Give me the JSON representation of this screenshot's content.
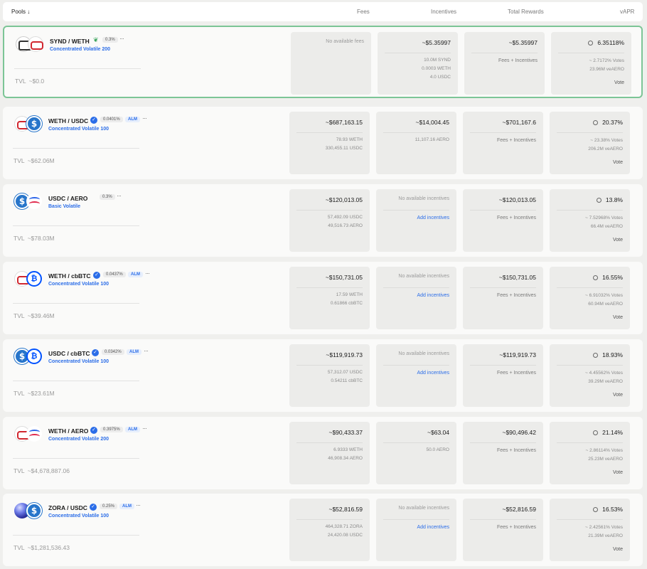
{
  "header": {
    "pools": "Pools ↓",
    "fees": "Fees",
    "incentives": "Incentives",
    "total_rewards": "Total Rewards",
    "vapr": "vAPR"
  },
  "common": {
    "tvl_label": "TVL",
    "no_fees": "No available fees",
    "no_incentives": "No available incentives",
    "add_incentives": "Add incentives",
    "fees_incentives": "Fees + Incentives",
    "vote": "Vote",
    "votes_suffix": "Votes",
    "veaero_suffix": "veAERO",
    "more": "···"
  },
  "pools": [
    {
      "pair": "SYND / WETH",
      "fee": "0.3%",
      "type": "Concentrated Volatile 200",
      "tvl": "~$0.0",
      "fees": {
        "na": "No available fees"
      },
      "incentives": {
        "total": "~$5.35997",
        "lines": [
          "10.0M SYND",
          "0.0003 WETH",
          "4.0 USDC"
        ]
      },
      "total": "~$5.35997",
      "vapr": "6.35118%",
      "votes": "~ 2.7172% Votes",
      "veaero": "23.96M veAERO"
    },
    {
      "pair": "WETH / USDC",
      "fee": "0.0401%",
      "alm": "ALM",
      "type": "Concentrated Volatile 100",
      "tvl": "~$62.06M",
      "fees": {
        "total": "~$687,163.15",
        "lines": [
          "78.93 WETH",
          "330,455.11 USDC"
        ]
      },
      "incentives": {
        "total": "~$14,004.45",
        "lines": [
          "11,107.16 AERO"
        ]
      },
      "total": "~$701,167.6",
      "vapr": "20.37%",
      "votes": "~ 23.38% Votes",
      "veaero": "206.2M veAERO"
    },
    {
      "pair": "USDC / AERO",
      "fee": "0.3%",
      "type": "Basic Volatile",
      "tvl": "~$78.03M",
      "fees": {
        "total": "~$120,013.05",
        "lines": [
          "57,492.09 USDC",
          "49,516.73 AERO"
        ]
      },
      "incentives": {
        "na": "No available incentives"
      },
      "total": "~$120,013.05",
      "vapr": "13.8%",
      "votes": "~ 7.52968% Votes",
      "veaero": "66.4M veAERO"
    },
    {
      "pair": "WETH / cbBTC",
      "fee": "0.0437%",
      "alm": "ALM",
      "type": "Concentrated Volatile 100",
      "tvl": "~$39.46M",
      "fees": {
        "total": "~$150,731.05",
        "lines": [
          "17.59 WETH",
          "0.61866 cbBTC"
        ]
      },
      "incentives": {
        "na": "No available incentives"
      },
      "total": "~$150,731.05",
      "vapr": "16.55%",
      "votes": "~ 6.91032% Votes",
      "veaero": "60.94M veAERO"
    },
    {
      "pair": "USDC / cbBTC",
      "fee": "0.0342%",
      "alm": "ALM",
      "type": "Concentrated Volatile 100",
      "tvl": "~$23.61M",
      "fees": {
        "total": "~$119,919.73",
        "lines": [
          "57,312.07 USDC",
          "0.54211 cbBTC"
        ]
      },
      "incentives": {
        "na": "No available incentives"
      },
      "total": "~$119,919.73",
      "vapr": "18.93%",
      "votes": "~ 4.45562% Votes",
      "veaero": "39.29M veAERO"
    },
    {
      "pair": "WETH / AERO",
      "fee": "0.3975%",
      "alm": "ALM",
      "type": "Concentrated Volatile 200",
      "tvl": "~$4,678,887.06",
      "fees": {
        "total": "~$90,433.37",
        "lines": [
          "6.9333 WETH",
          "46,908.34 AERO"
        ]
      },
      "incentives": {
        "total": "~$63.04",
        "lines": [
          "50.0 AERO"
        ]
      },
      "total": "~$90,496.42",
      "vapr": "21.14%",
      "votes": "~ 2.86114% Votes",
      "veaero": "25.23M veAERO"
    },
    {
      "pair": "ZORA / USDC",
      "fee": "0.25%",
      "alm": "ALM",
      "type": "Concentrated Volatile 100",
      "tvl": "~$1,281,536.43",
      "fees": {
        "total": "~$52,816.59",
        "lines": [
          "464,328.71 ZORA",
          "24,420.08 USDC"
        ]
      },
      "incentives": {
        "na": "No available incentives"
      },
      "total": "~$52,816.59",
      "vapr": "16.53%",
      "votes": "~ 2.42561% Votes",
      "veaero": "21.39M veAERO"
    }
  ]
}
